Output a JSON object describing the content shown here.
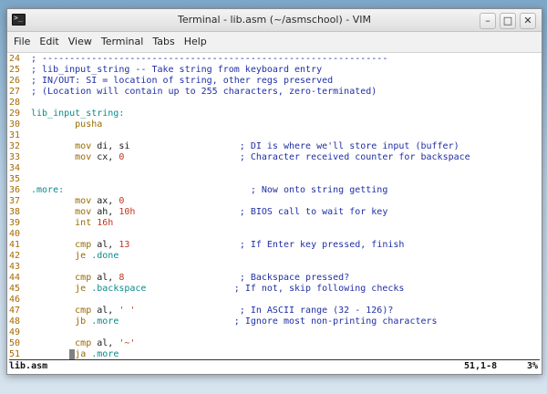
{
  "window": {
    "title": "Terminal - lib.asm (~/asmschool) - VIM",
    "app_icon_glyph": ">_",
    "buttons": {
      "minimize": "–",
      "maximize": "□",
      "close": "✕"
    }
  },
  "menu": [
    "File",
    "Edit",
    "View",
    "Terminal",
    "Tabs",
    "Help"
  ],
  "editor": {
    "lines": [
      {
        "n": "24",
        "parts": [
          {
            "t": "; ---------------------------------------------------------------",
            "c": "cm"
          }
        ]
      },
      {
        "n": "25",
        "parts": [
          {
            "t": "; lib_input_string -- Take string from keyboard entry",
            "c": "cm"
          }
        ]
      },
      {
        "n": "26",
        "parts": [
          {
            "t": "; IN/OUT: SI = location of string, other regs preserved",
            "c": "cm"
          }
        ]
      },
      {
        "n": "27",
        "parts": [
          {
            "t": "; (Location will contain up to 255 characters, zero-terminated)",
            "c": "cm"
          }
        ]
      },
      {
        "n": "28",
        "parts": []
      },
      {
        "n": "29",
        "parts": [
          {
            "t": "lib_input_string:",
            "c": "lb"
          }
        ]
      },
      {
        "n": "30",
        "parts": [
          {
            "t": "        pusha",
            "c": "kw"
          }
        ]
      },
      {
        "n": "31",
        "parts": []
      },
      {
        "n": "32",
        "parts": [
          {
            "t": "        mov",
            "c": "kw"
          },
          {
            "t": " di, si                    ",
            "c": "tx"
          },
          {
            "t": "; DI is where we'll store input (buffer)",
            "c": "cm"
          }
        ]
      },
      {
        "n": "33",
        "parts": [
          {
            "t": "        mov",
            "c": "kw"
          },
          {
            "t": " cx, ",
            "c": "tx"
          },
          {
            "t": "0",
            "c": "nm"
          },
          {
            "t": "                     ",
            "c": "tx"
          },
          {
            "t": "; Character received counter for backspace",
            "c": "cm"
          }
        ]
      },
      {
        "n": "34",
        "parts": []
      },
      {
        "n": "35",
        "parts": []
      },
      {
        "n": "36",
        "parts": [
          {
            "t": ".more:",
            "c": "lb"
          },
          {
            "t": "                                  ",
            "c": "tx"
          },
          {
            "t": "; Now onto string getting",
            "c": "cm"
          }
        ]
      },
      {
        "n": "37",
        "parts": [
          {
            "t": "        mov",
            "c": "kw"
          },
          {
            "t": " ax, ",
            "c": "tx"
          },
          {
            "t": "0",
            "c": "nm"
          }
        ]
      },
      {
        "n": "38",
        "parts": [
          {
            "t": "        mov",
            "c": "kw"
          },
          {
            "t": " ah, ",
            "c": "tx"
          },
          {
            "t": "10h",
            "c": "nm"
          },
          {
            "t": "                   ",
            "c": "tx"
          },
          {
            "t": "; BIOS call to wait for key",
            "c": "cm"
          }
        ]
      },
      {
        "n": "39",
        "parts": [
          {
            "t": "        int",
            "c": "kw"
          },
          {
            "t": " ",
            "c": "tx"
          },
          {
            "t": "16h",
            "c": "nm"
          }
        ]
      },
      {
        "n": "40",
        "parts": []
      },
      {
        "n": "41",
        "parts": [
          {
            "t": "        cmp",
            "c": "kw"
          },
          {
            "t": " al, ",
            "c": "tx"
          },
          {
            "t": "13",
            "c": "nm"
          },
          {
            "t": "                    ",
            "c": "tx"
          },
          {
            "t": "; If Enter key pressed, finish",
            "c": "cm"
          }
        ]
      },
      {
        "n": "42",
        "parts": [
          {
            "t": "        je",
            "c": "kw"
          },
          {
            "t": " .done",
            "c": "ref"
          }
        ]
      },
      {
        "n": "43",
        "parts": []
      },
      {
        "n": "44",
        "parts": [
          {
            "t": "        cmp",
            "c": "kw"
          },
          {
            "t": " al, ",
            "c": "tx"
          },
          {
            "t": "8",
            "c": "nm"
          },
          {
            "t": "                     ",
            "c": "tx"
          },
          {
            "t": "; Backspace pressed?",
            "c": "cm"
          }
        ]
      },
      {
        "n": "45",
        "parts": [
          {
            "t": "        je",
            "c": "kw"
          },
          {
            "t": " .backspace",
            "c": "ref"
          },
          {
            "t": "                ",
            "c": "tx"
          },
          {
            "t": "; If not, skip following checks",
            "c": "cm"
          }
        ]
      },
      {
        "n": "46",
        "parts": []
      },
      {
        "n": "47",
        "parts": [
          {
            "t": "        cmp",
            "c": "kw"
          },
          {
            "t": " al, ",
            "c": "tx"
          },
          {
            "t": "' '",
            "c": "nm"
          },
          {
            "t": "                   ",
            "c": "tx"
          },
          {
            "t": "; In ASCII range (32 - 126)?",
            "c": "cm"
          }
        ]
      },
      {
        "n": "48",
        "parts": [
          {
            "t": "        jb",
            "c": "kw"
          },
          {
            "t": " .more",
            "c": "ref"
          },
          {
            "t": "                     ",
            "c": "tx"
          },
          {
            "t": "; Ignore most non-printing characters",
            "c": "cm"
          }
        ]
      },
      {
        "n": "49",
        "parts": []
      },
      {
        "n": "50",
        "parts": [
          {
            "t": "        cmp",
            "c": "kw"
          },
          {
            "t": " al, ",
            "c": "tx"
          },
          {
            "t": "'~'",
            "c": "nm"
          }
        ]
      },
      {
        "n": "51",
        "parts": [
          {
            "t": "       ",
            "c": "tx"
          },
          {
            "t": " ",
            "c": "cursor"
          },
          {
            "t": "ja",
            "c": "kw"
          },
          {
            "t": " .more",
            "c": "ref"
          }
        ]
      }
    ]
  },
  "status": {
    "filename": "lib.asm",
    "position": "51,1-8",
    "percent": "3%"
  }
}
